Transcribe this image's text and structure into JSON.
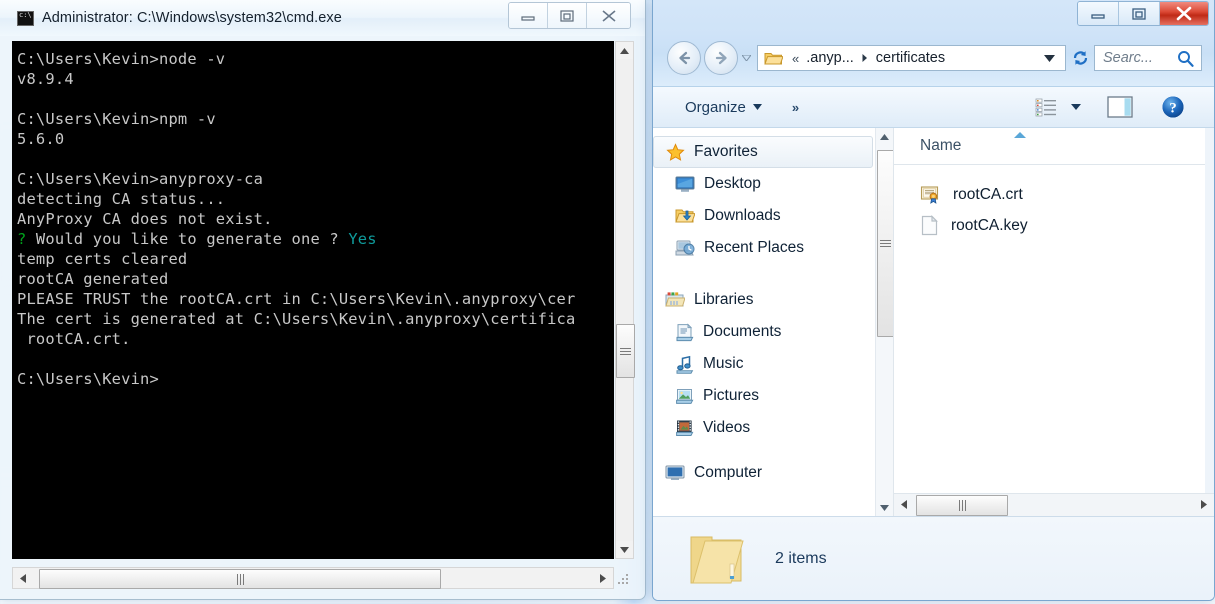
{
  "cmd_window": {
    "title": "Administrator: C:\\Windows\\system32\\cmd.exe",
    "icon": "cmd-console-icon",
    "window_controls": {
      "minimize": "minimize-icon",
      "maximize": "maximize-icon",
      "close": "close-icon"
    },
    "console": {
      "lines": [
        {
          "text": "C:\\Users\\Kevin>node -v"
        },
        {
          "text": "v8.9.4"
        },
        {
          "text": ""
        },
        {
          "text": "C:\\Users\\Kevin>npm -v"
        },
        {
          "text": "5.6.0"
        },
        {
          "text": ""
        },
        {
          "text": "C:\\Users\\Kevin>anyproxy-ca"
        },
        {
          "text": "detecting CA status..."
        },
        {
          "text": "AnyProxy CA does not exist."
        },
        {
          "prefix": "?",
          "prefix_color": "green",
          "text": " Would you like to generate one ? ",
          "suffix": "Yes",
          "suffix_color": "teal"
        },
        {
          "text": "temp certs cleared"
        },
        {
          "text": "rootCA generated"
        },
        {
          "text": "PLEASE TRUST the rootCA.crt in C:\\Users\\Kevin\\.anyproxy\\cer"
        },
        {
          "text": "The cert is generated at C:\\Users\\Kevin\\.anyproxy\\certifica"
        },
        {
          "text": " rootCA.crt."
        },
        {
          "text": ""
        },
        {
          "text": "C:\\Users\\Kevin>"
        }
      ],
      "foreground_color": "#c8c8c8",
      "background_color": "#000000",
      "green_color": "#00a21c",
      "teal_color": "#0f9b9b"
    }
  },
  "explorer_window": {
    "window_controls": {
      "minimize": "minimize-icon",
      "maximize": "maximize-icon",
      "close": "close-icon"
    },
    "navigation": {
      "back": "back-arrow-icon",
      "forward": "forward-arrow-icon",
      "history": "chevron-down-icon",
      "refresh": "refresh-icon"
    },
    "address_bar": {
      "folder_icon": "folder-icon",
      "overflow": "«",
      "crumbs": [
        ".anyp...",
        "certificates"
      ],
      "separator": "▸",
      "dropdown": "chevron-down-icon"
    },
    "search": {
      "placeholder": "Searc...",
      "icon": "search-icon"
    },
    "toolbar": {
      "organize_label": "Organize",
      "organize_dropdown": "chevron-down-icon",
      "more_label": "»",
      "views_icon": "view-list-icon",
      "views_dropdown": "chevron-down-icon",
      "preview_pane_icon": "preview-pane-icon",
      "help_icon": "help-icon"
    },
    "nav_pane": {
      "items": [
        {
          "label": "Favorites",
          "icon": "star-icon",
          "level": 0,
          "selected": true
        },
        {
          "label": "Desktop",
          "icon": "desktop-icon",
          "level": 1,
          "selected": false
        },
        {
          "label": "Downloads",
          "icon": "downloads-icon",
          "level": 1,
          "selected": false
        },
        {
          "label": "Recent Places",
          "icon": "recent-places-icon",
          "level": 1,
          "selected": false
        },
        {
          "label": "Libraries",
          "icon": "libraries-icon",
          "level": 0,
          "selected": false,
          "gap_before": true
        },
        {
          "label": "Documents",
          "icon": "documents-icon",
          "level": 1,
          "selected": false
        },
        {
          "label": "Music",
          "icon": "music-icon",
          "level": 1,
          "selected": false
        },
        {
          "label": "Pictures",
          "icon": "pictures-icon",
          "level": 1,
          "selected": false
        },
        {
          "label": "Videos",
          "icon": "videos-icon",
          "level": 1,
          "selected": false
        },
        {
          "label": "Computer",
          "icon": "computer-icon",
          "level": 0,
          "selected": false,
          "gap_before": true,
          "clipped": true
        }
      ]
    },
    "file_list": {
      "column_header": "Name",
      "sort_indicator": "sort-ascending-icon",
      "files": [
        {
          "name": "rootCA.crt",
          "icon": "certificate-icon"
        },
        {
          "name": "rootCA.key",
          "icon": "blank-document-icon"
        }
      ]
    },
    "status_bar": {
      "folder_icon": "folder-large-icon",
      "item_count": "2 items"
    }
  }
}
